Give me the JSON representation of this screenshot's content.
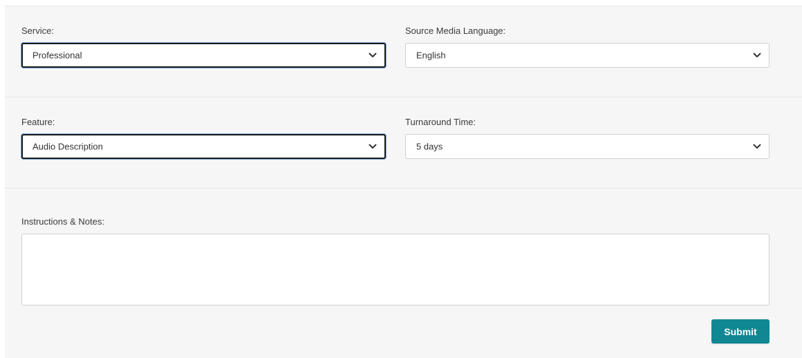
{
  "service": {
    "label": "Service:",
    "value": "Professional"
  },
  "source_language": {
    "label": "Source Media Language:",
    "value": "English"
  },
  "feature": {
    "label": "Feature:",
    "value": "Audio Description"
  },
  "turnaround": {
    "label": "Turnaround Time:",
    "value": "5 days"
  },
  "notes": {
    "label": "Instructions & Notes:",
    "value": ""
  },
  "submit": {
    "label": "Submit"
  },
  "colors": {
    "accent": "#118793",
    "panel_bg": "#f6f6f6",
    "focus_ring": "#7aa7d8"
  },
  "icons": {
    "select_arrow": "chevron-down-icon"
  }
}
